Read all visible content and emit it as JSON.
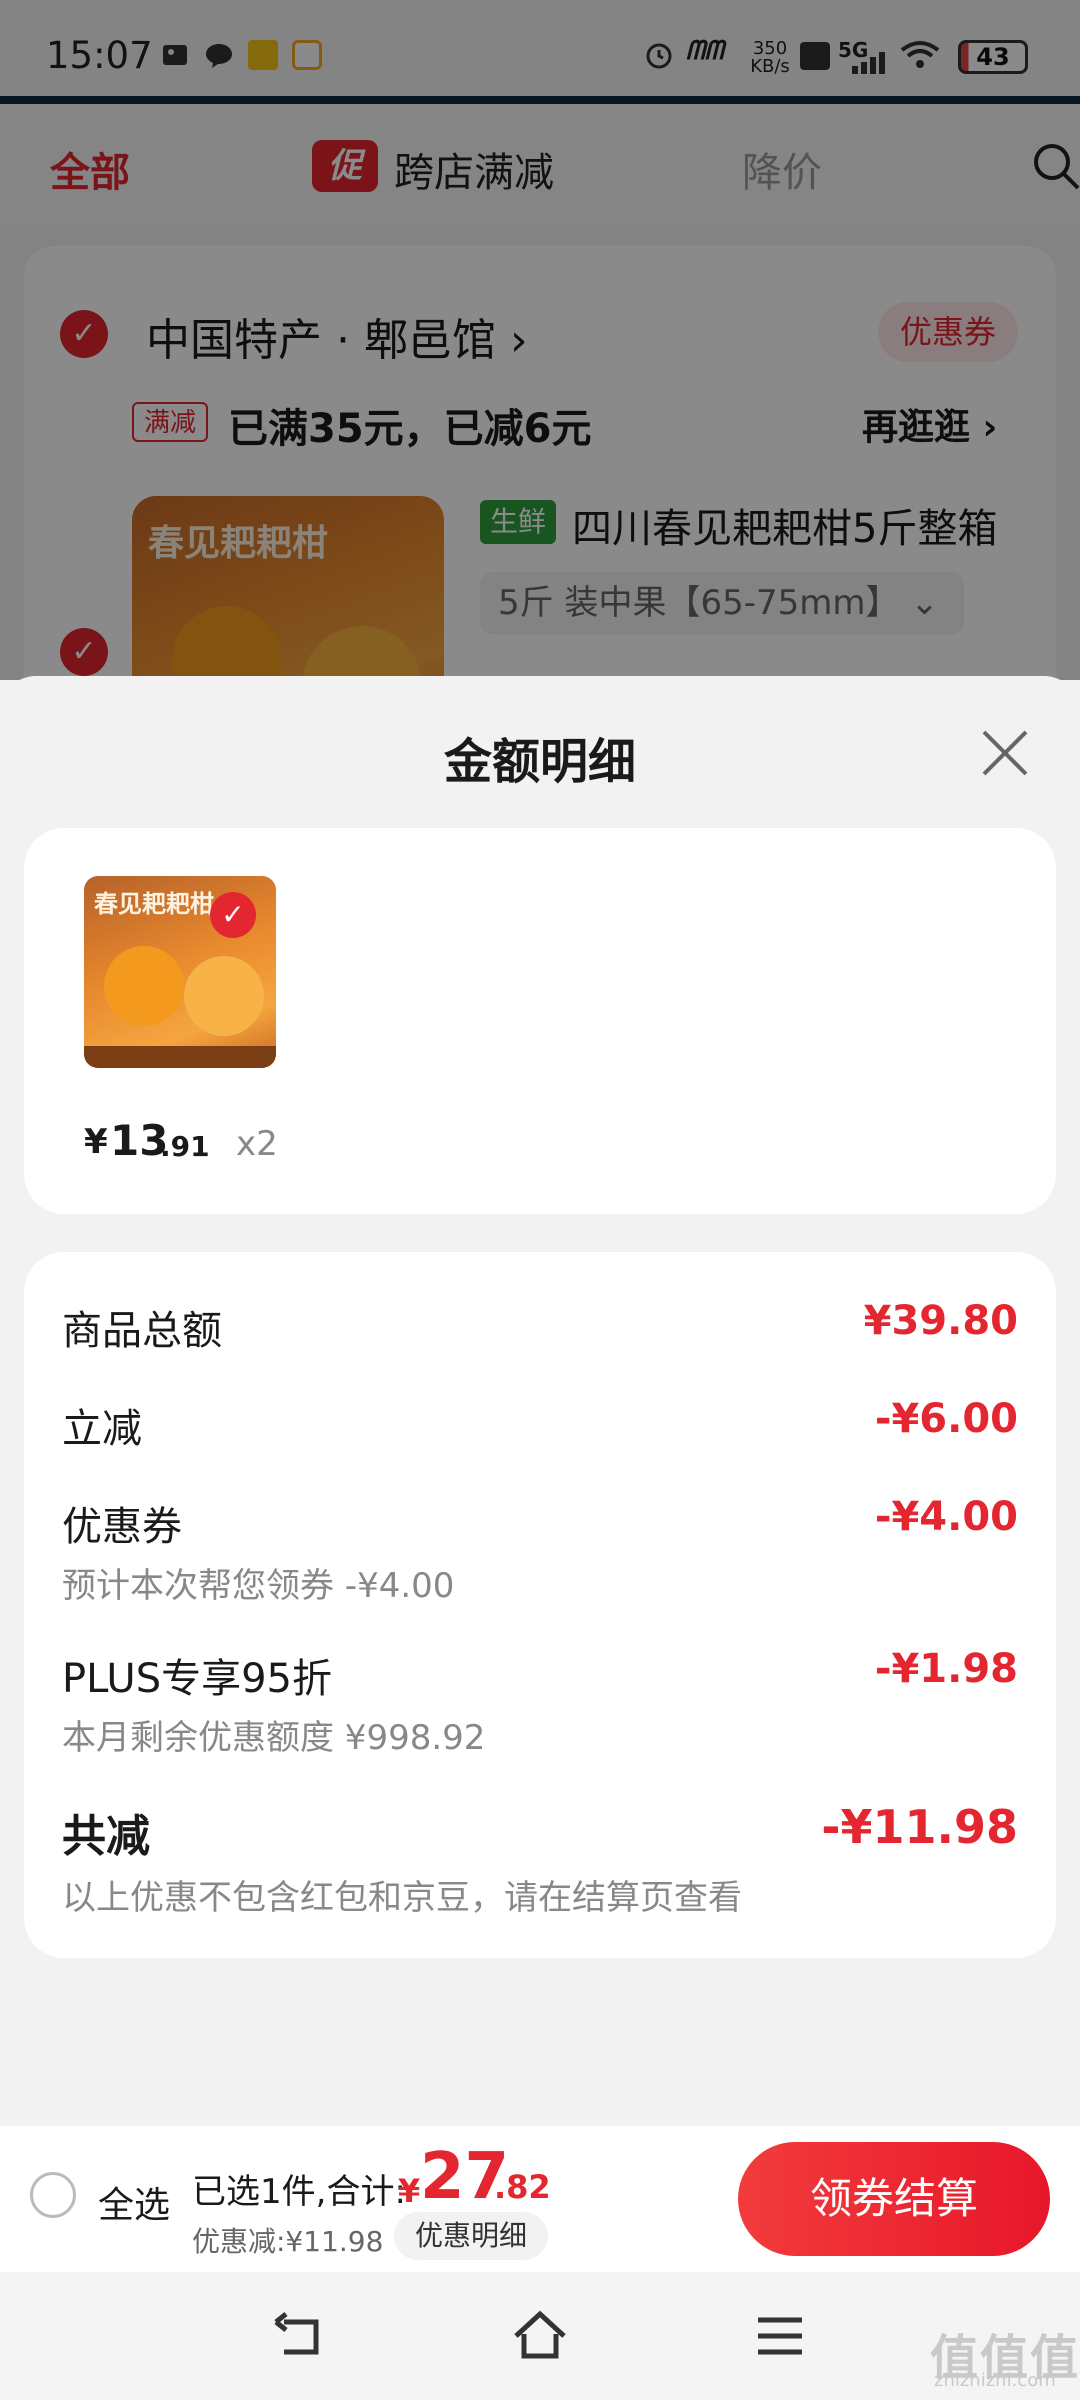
{
  "status_bar": {
    "time": "15:07",
    "net_speed": "350 KB/s",
    "network": "5G",
    "battery": "43"
  },
  "tabs": {
    "all": "全部",
    "promo_badge": "促",
    "cross_store": "跨店满减",
    "price_drop": "降价"
  },
  "store": {
    "name": "中国特产 · 郫邑馆 ›",
    "coupon": "优惠券",
    "promo_tag": "满减",
    "promo_text": "已满35元，已减6元",
    "browse": "再逛逛 ›",
    "product_tag": "生鲜",
    "product_title": "四川春见耙耙柑5斤整箱",
    "sku": "5斤 装中果【65-75mm】 ⌄"
  },
  "sheet": {
    "title": "金额明细",
    "item": {
      "price_symbol": "¥",
      "price_int": "13",
      "price_dec": ".91",
      "qty": "x2"
    },
    "rows": [
      {
        "label": "商品总额",
        "value": "¥39.80",
        "sub": ""
      },
      {
        "label": "立减",
        "value": "-¥6.00",
        "sub": ""
      },
      {
        "label": "优惠券",
        "value": "-¥4.00",
        "sub": "预计本次帮您领券 -¥4.00"
      },
      {
        "label": "PLUS专享95折",
        "value": "-¥1.98",
        "sub": "本月剩余优惠额度 ¥998.92"
      }
    ],
    "total": {
      "label": "共减",
      "value": "-¥11.98",
      "sub": "以上优惠不包含红包和京豆，请在结算页查看"
    }
  },
  "bottom": {
    "select_all": "全选",
    "selected": "已选1件,合计:",
    "total_symbol": "¥",
    "total_int": "27",
    "total_dec": ".82",
    "discount": "优惠减:¥11.98",
    "detail": "优惠明细",
    "checkout": "领券结算"
  },
  "watermark": {
    "main": "值值值",
    "sub": "zhizhizhi.com"
  },
  "colors": {
    "accent": "#e3262f",
    "fresh": "#2e9e3d"
  }
}
